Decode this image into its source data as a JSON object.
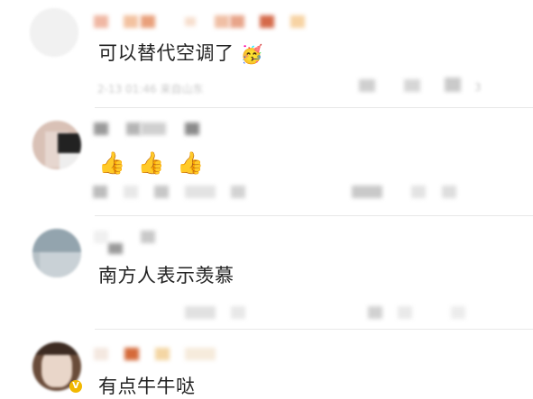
{
  "comments": [
    {
      "text": "可以替代空调了",
      "emoji": "🥳",
      "meta_time_location": "2-13 01:46 来自山东",
      "meta_like_count": "3"
    },
    {
      "thumbs": [
        "👍",
        "👍",
        "👍"
      ]
    },
    {
      "text": "南方人表示羡慕"
    },
    {
      "text": "有点牛牛哒",
      "verified_badge": "V"
    }
  ],
  "colors": {
    "text": "#222222",
    "meta": "#c8c8c8",
    "divider": "#e8e8e8",
    "badge": "#f2b800"
  }
}
